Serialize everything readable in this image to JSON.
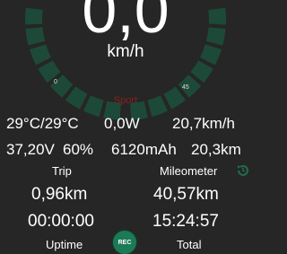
{
  "speedometer": {
    "speed": "0,0",
    "unit": "km/h",
    "scale_min": "0",
    "scale_max": "45",
    "mode": "Sport",
    "speed_fraction": 0,
    "colors": {
      "active": "#2aa26f",
      "inactive": "#1d4a38",
      "mode": "#8a1f1f"
    }
  },
  "stats": {
    "temperature": "29°C/29°C",
    "power": "0,0W",
    "avg_speed": "20,7km/h",
    "voltage": "37,20V",
    "battery": "60%",
    "capacity": "6120mAh",
    "range": "20,3km"
  },
  "trip": {
    "label": "Trip",
    "distance": "0,96km",
    "time": "00:00:00",
    "time_label": "Uptime"
  },
  "mileometer": {
    "label": "Mileometer",
    "distance": "40,57km",
    "time": "15:24:57",
    "time_label": "Total"
  },
  "controls": {
    "rec_label": "REC",
    "history_icon": "history-icon"
  }
}
